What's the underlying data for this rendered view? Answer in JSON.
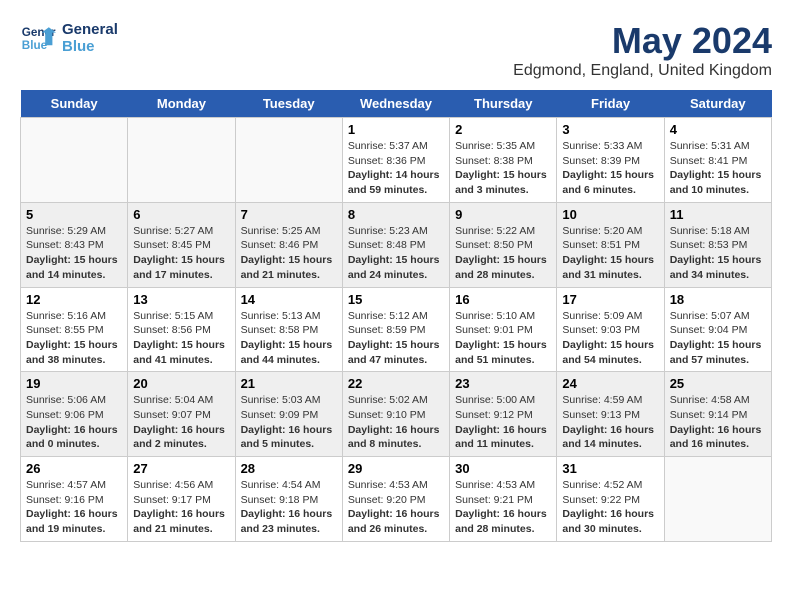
{
  "header": {
    "logo_line1": "General",
    "logo_line2": "Blue",
    "title": "May 2024",
    "subtitle": "Edgmond, England, United Kingdom"
  },
  "days_of_week": [
    "Sunday",
    "Monday",
    "Tuesday",
    "Wednesday",
    "Thursday",
    "Friday",
    "Saturday"
  ],
  "weeks": [
    [
      {
        "day": "",
        "content": ""
      },
      {
        "day": "",
        "content": ""
      },
      {
        "day": "",
        "content": ""
      },
      {
        "day": "1",
        "content": "Sunrise: 5:37 AM\nSunset: 8:36 PM\nDaylight: 14 hours and 59 minutes."
      },
      {
        "day": "2",
        "content": "Sunrise: 5:35 AM\nSunset: 8:38 PM\nDaylight: 15 hours and 3 minutes."
      },
      {
        "day": "3",
        "content": "Sunrise: 5:33 AM\nSunset: 8:39 PM\nDaylight: 15 hours and 6 minutes."
      },
      {
        "day": "4",
        "content": "Sunrise: 5:31 AM\nSunset: 8:41 PM\nDaylight: 15 hours and 10 minutes."
      }
    ],
    [
      {
        "day": "5",
        "content": "Sunrise: 5:29 AM\nSunset: 8:43 PM\nDaylight: 15 hours and 14 minutes."
      },
      {
        "day": "6",
        "content": "Sunrise: 5:27 AM\nSunset: 8:45 PM\nDaylight: 15 hours and 17 minutes."
      },
      {
        "day": "7",
        "content": "Sunrise: 5:25 AM\nSunset: 8:46 PM\nDaylight: 15 hours and 21 minutes."
      },
      {
        "day": "8",
        "content": "Sunrise: 5:23 AM\nSunset: 8:48 PM\nDaylight: 15 hours and 24 minutes."
      },
      {
        "day": "9",
        "content": "Sunrise: 5:22 AM\nSunset: 8:50 PM\nDaylight: 15 hours and 28 minutes."
      },
      {
        "day": "10",
        "content": "Sunrise: 5:20 AM\nSunset: 8:51 PM\nDaylight: 15 hours and 31 minutes."
      },
      {
        "day": "11",
        "content": "Sunrise: 5:18 AM\nSunset: 8:53 PM\nDaylight: 15 hours and 34 minutes."
      }
    ],
    [
      {
        "day": "12",
        "content": "Sunrise: 5:16 AM\nSunset: 8:55 PM\nDaylight: 15 hours and 38 minutes."
      },
      {
        "day": "13",
        "content": "Sunrise: 5:15 AM\nSunset: 8:56 PM\nDaylight: 15 hours and 41 minutes."
      },
      {
        "day": "14",
        "content": "Sunrise: 5:13 AM\nSunset: 8:58 PM\nDaylight: 15 hours and 44 minutes."
      },
      {
        "day": "15",
        "content": "Sunrise: 5:12 AM\nSunset: 8:59 PM\nDaylight: 15 hours and 47 minutes."
      },
      {
        "day": "16",
        "content": "Sunrise: 5:10 AM\nSunset: 9:01 PM\nDaylight: 15 hours and 51 minutes."
      },
      {
        "day": "17",
        "content": "Sunrise: 5:09 AM\nSunset: 9:03 PM\nDaylight: 15 hours and 54 minutes."
      },
      {
        "day": "18",
        "content": "Sunrise: 5:07 AM\nSunset: 9:04 PM\nDaylight: 15 hours and 57 minutes."
      }
    ],
    [
      {
        "day": "19",
        "content": "Sunrise: 5:06 AM\nSunset: 9:06 PM\nDaylight: 16 hours and 0 minutes."
      },
      {
        "day": "20",
        "content": "Sunrise: 5:04 AM\nSunset: 9:07 PM\nDaylight: 16 hours and 2 minutes."
      },
      {
        "day": "21",
        "content": "Sunrise: 5:03 AM\nSunset: 9:09 PM\nDaylight: 16 hours and 5 minutes."
      },
      {
        "day": "22",
        "content": "Sunrise: 5:02 AM\nSunset: 9:10 PM\nDaylight: 16 hours and 8 minutes."
      },
      {
        "day": "23",
        "content": "Sunrise: 5:00 AM\nSunset: 9:12 PM\nDaylight: 16 hours and 11 minutes."
      },
      {
        "day": "24",
        "content": "Sunrise: 4:59 AM\nSunset: 9:13 PM\nDaylight: 16 hours and 14 minutes."
      },
      {
        "day": "25",
        "content": "Sunrise: 4:58 AM\nSunset: 9:14 PM\nDaylight: 16 hours and 16 minutes."
      }
    ],
    [
      {
        "day": "26",
        "content": "Sunrise: 4:57 AM\nSunset: 9:16 PM\nDaylight: 16 hours and 19 minutes."
      },
      {
        "day": "27",
        "content": "Sunrise: 4:56 AM\nSunset: 9:17 PM\nDaylight: 16 hours and 21 minutes."
      },
      {
        "day": "28",
        "content": "Sunrise: 4:54 AM\nSunset: 9:18 PM\nDaylight: 16 hours and 23 minutes."
      },
      {
        "day": "29",
        "content": "Sunrise: 4:53 AM\nSunset: 9:20 PM\nDaylight: 16 hours and 26 minutes."
      },
      {
        "day": "30",
        "content": "Sunrise: 4:53 AM\nSunset: 9:21 PM\nDaylight: 16 hours and 28 minutes."
      },
      {
        "day": "31",
        "content": "Sunrise: 4:52 AM\nSunset: 9:22 PM\nDaylight: 16 hours and 30 minutes."
      },
      {
        "day": "",
        "content": ""
      }
    ]
  ]
}
